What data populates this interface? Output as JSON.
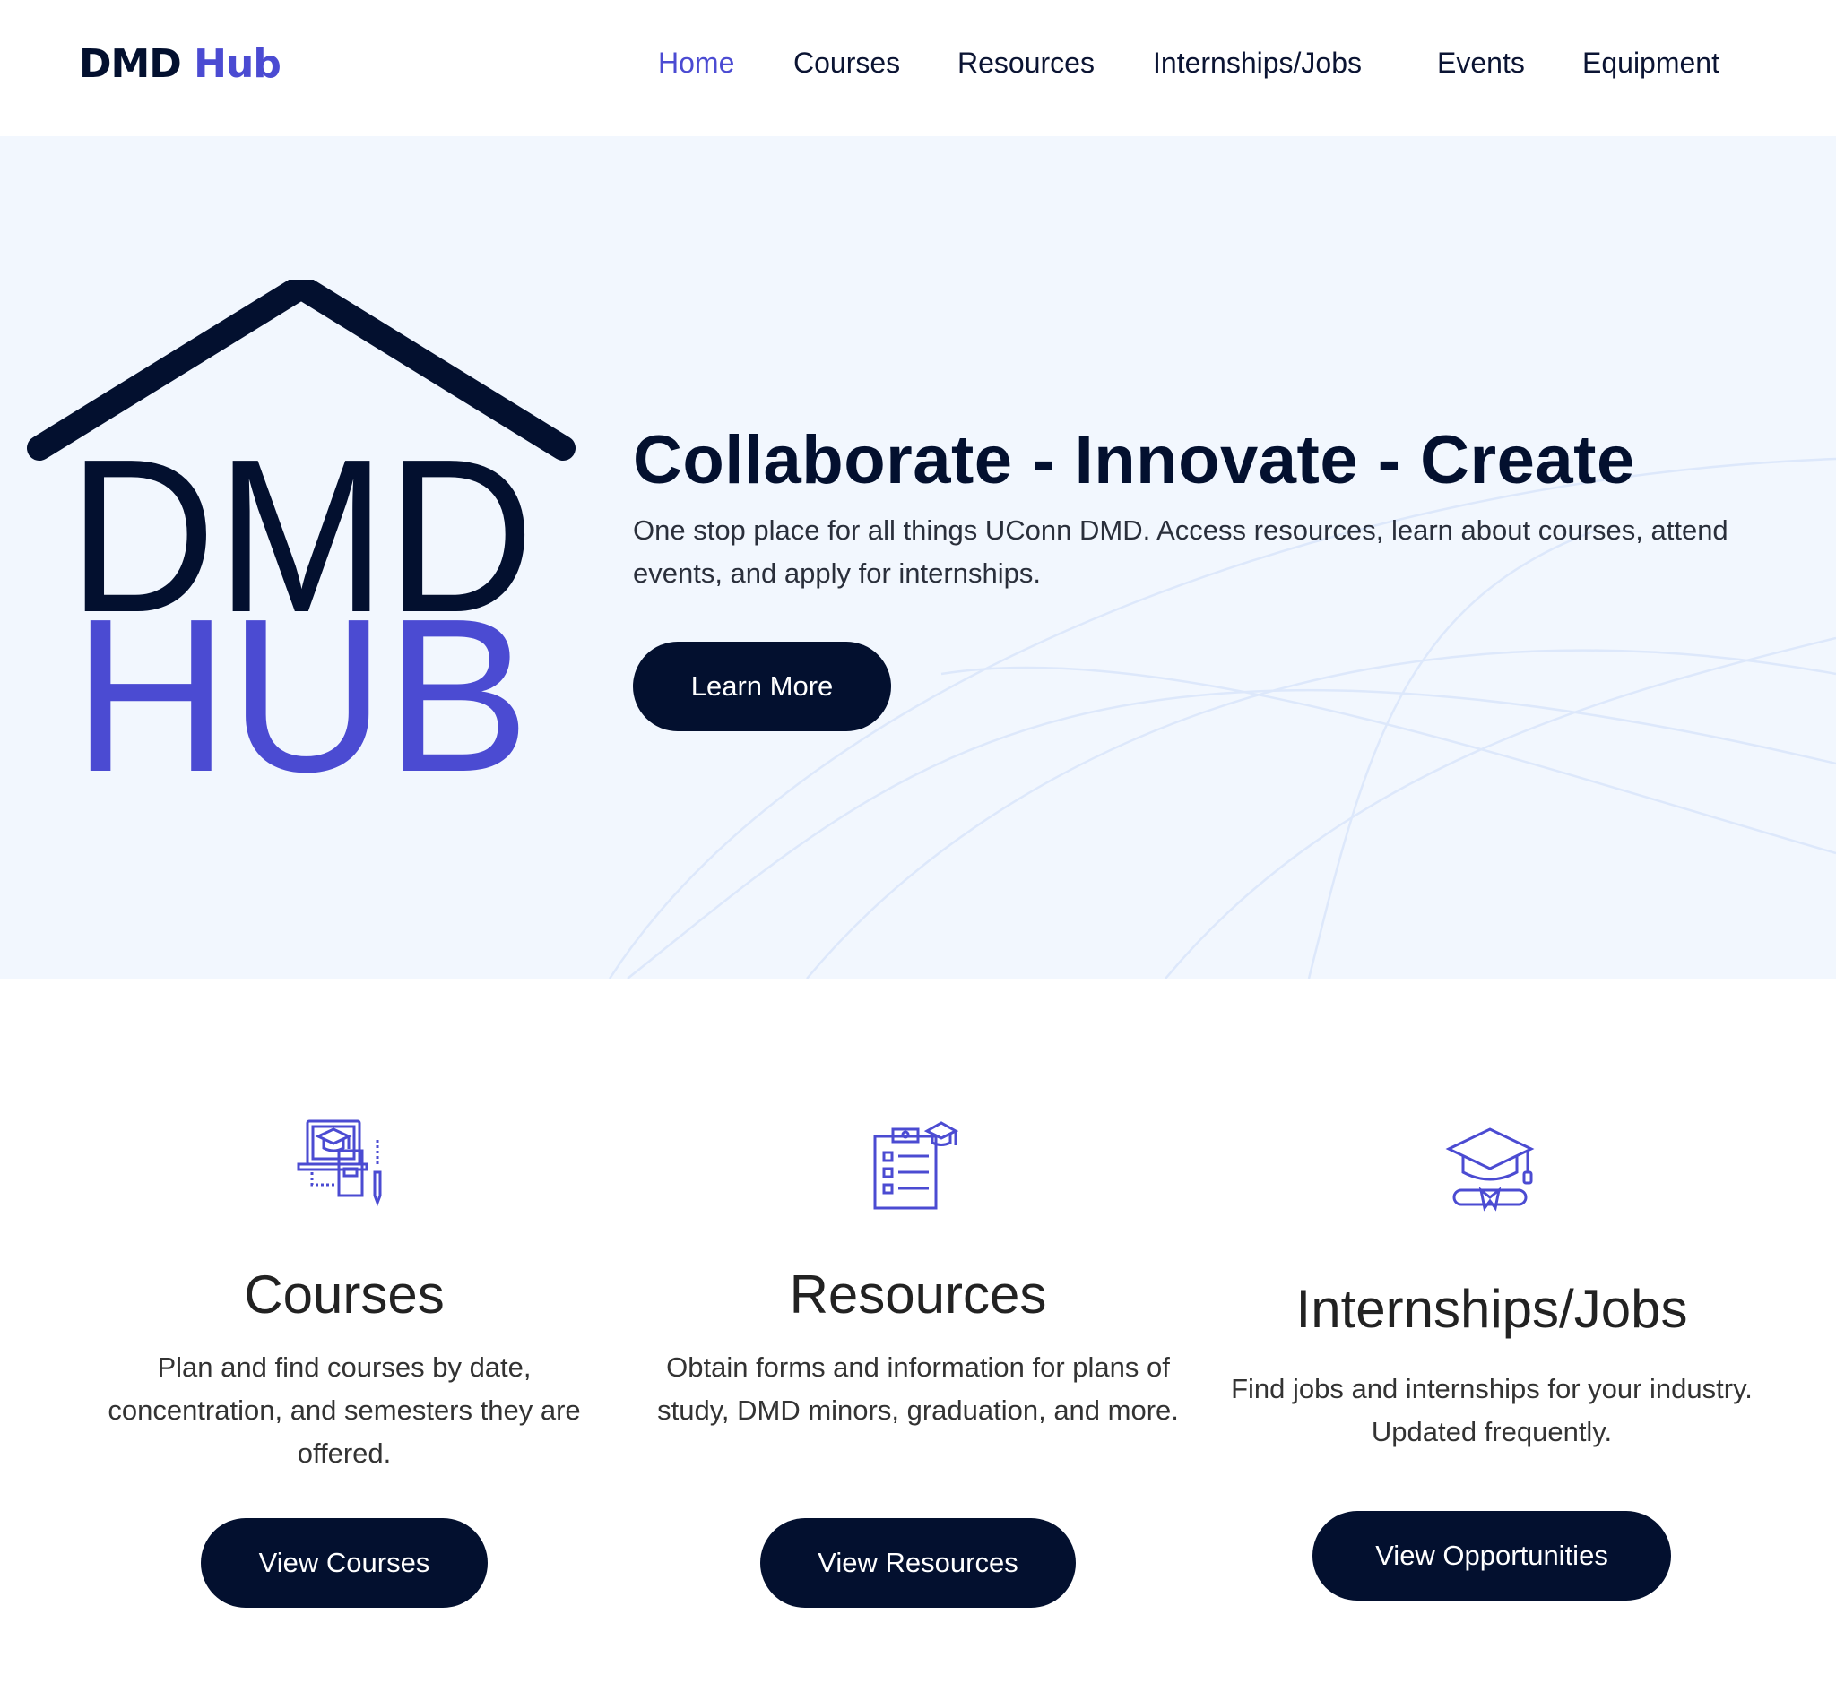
{
  "header": {
    "brand_part1": "DMD",
    "brand_part2": "Hub",
    "nav": [
      "Home",
      "Courses",
      "Resources",
      "Internships/Jobs",
      "Events",
      "Equipment"
    ],
    "active_nav": "Home"
  },
  "hero": {
    "logo_line1": "DMD",
    "logo_line2": "HUB",
    "title": "Collaborate - Innovate - Create",
    "description": "One stop place for all things UConn DMD. Access resources, learn about courses, attend events, and apply for internships.",
    "button": "Learn More"
  },
  "features": [
    {
      "icon": "laptop-graduation-icon",
      "title": "Courses",
      "description": "Plan and find courses by date, concentration, and semesters they are offered.",
      "button": "View Courses"
    },
    {
      "icon": "clipboard-checklist-icon",
      "title": "Resources",
      "description": "Obtain forms and information for plans of study, DMD minors, graduation, and more.",
      "button": "View Resources"
    },
    {
      "icon": "graduation-cap-diploma-icon",
      "title": "Internships/Jobs",
      "description": "Find jobs and internships for your industry. Updated frequently.",
      "button": "View Opportunities"
    }
  ],
  "colors": {
    "navy": "#03102f",
    "accent": "#4b4bd2",
    "hero_bg": "#f2f7fe"
  }
}
